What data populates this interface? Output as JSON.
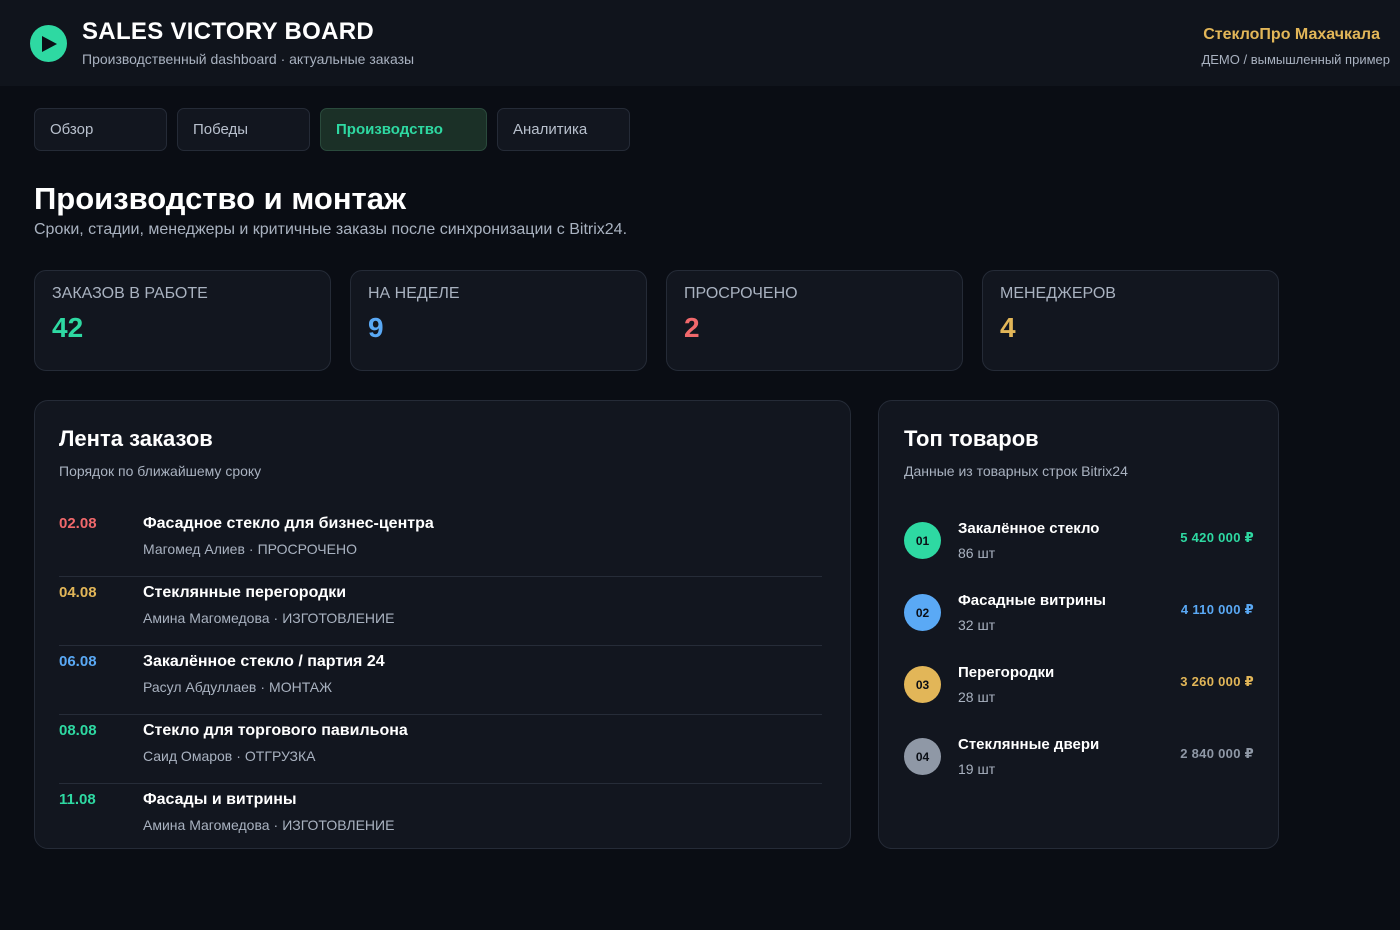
{
  "header": {
    "title": "SALES VICTORY BOARD",
    "subtitle": "Производственный dashboard · актуальные заказы",
    "company": "СтеклоПро Махачкала",
    "demo_note": "ДЕМО / вымышленный пример",
    "logo_icon": "play-icon"
  },
  "tabs": [
    {
      "label": "Обзор",
      "active": false
    },
    {
      "label": "Победы",
      "active": false
    },
    {
      "label": "Производство",
      "active": true
    },
    {
      "label": "Аналитика",
      "active": false
    }
  ],
  "page": {
    "title": "Производство и монтаж",
    "subtitle": "Сроки, стадии, менеджеры и критичные заказы после синхронизации с Bitrix24."
  },
  "stats": [
    {
      "label": "ЗАКАЗОВ В РАБОТЕ",
      "value": "42",
      "color": "#2ed9a2"
    },
    {
      "label": "НА НЕДЕЛЕ",
      "value": "9",
      "color": "#5aa9f5"
    },
    {
      "label": "ПРОСРОЧЕНО",
      "value": "2",
      "color": "#f0686b"
    },
    {
      "label": "МЕНЕДЖЕРОВ",
      "value": "4",
      "color": "#e2b658"
    }
  ],
  "orders_panel": {
    "title": "Лента заказов",
    "subtitle": "Порядок по ближайшему сроку",
    "orders": [
      {
        "date": "02.08",
        "date_color": "#f0686b",
        "name": "Фасадное стекло для бизнес-центра",
        "manager": "Магомед Алиев",
        "separator": "·",
        "status": "ПРОСРОЧЕНО"
      },
      {
        "date": "04.08",
        "date_color": "#e2b658",
        "name": "Стеклянные перегородки",
        "manager": "Амина Магомедова",
        "separator": "·",
        "status": "ИЗГОТОВЛЕНИЕ"
      },
      {
        "date": "06.08",
        "date_color": "#5aa9f5",
        "name": "Закалённое стекло / партия 24",
        "manager": "Расул Абдуллаев",
        "separator": "·",
        "status": "МОНТАЖ"
      },
      {
        "date": "08.08",
        "date_color": "#2ed9a2",
        "name": "Стекло для торгового павильона",
        "manager": "Саид Омаров",
        "separator": "·",
        "status": "ОТГРУЗКА"
      },
      {
        "date": "11.08",
        "date_color": "#2ed9a2",
        "name": "Фасады и витрины",
        "manager": "Амина Магомедова",
        "separator": "·",
        "status": "ИЗГОТОВЛЕНИЕ"
      }
    ]
  },
  "products_panel": {
    "title": "Топ товаров",
    "subtitle": "Данные из товарных строк Bitrix24",
    "products": [
      {
        "rank": "01",
        "name": "Закалённое стекло",
        "qty": "86 шт",
        "sum": "5 420 000 ₽",
        "color": "#2ed9a2"
      },
      {
        "rank": "02",
        "name": "Фасадные витрины",
        "qty": "32 шт",
        "sum": "4 110 000 ₽",
        "color": "#5aa9f5"
      },
      {
        "rank": "03",
        "name": "Перегородки",
        "qty": "28 шт",
        "sum": "3 260 000 ₽",
        "color": "#e2b658"
      },
      {
        "rank": "04",
        "name": "Стеклянные двери",
        "qty": "19 шт",
        "sum": "2 840 000 ₽",
        "color": "#8f98a6"
      }
    ]
  }
}
